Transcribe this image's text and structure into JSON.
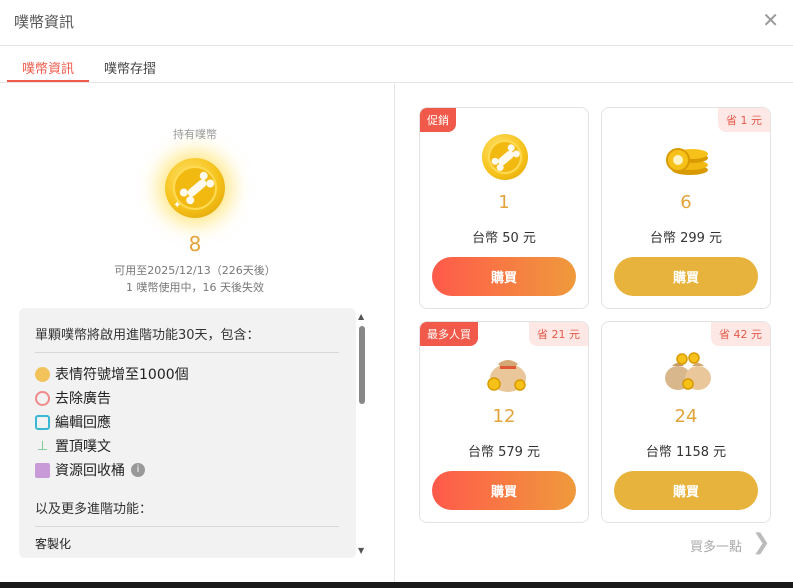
{
  "dialog": {
    "title": "噗幣資訊",
    "close_icon": "close-icon"
  },
  "tabs": [
    {
      "label": "噗幣資訊",
      "active": true
    },
    {
      "label": "噗幣存摺",
      "active": false
    }
  ],
  "holdings": {
    "label": "持有噗幣",
    "count": "8",
    "valid_until": "可用至2025/12/13（226天後）",
    "usage_status": "1 噗幣使用中，16 天後失效"
  },
  "features": {
    "intro": "單顆噗幣將啟用進階功能30天，包含：",
    "items": [
      {
        "label": "表情符號增至1000個",
        "icon": "smiley-icon",
        "color": "#f2c35a"
      },
      {
        "label": "去除廣告",
        "icon": "no-ads-icon",
        "color": "#f08a8a"
      },
      {
        "label": "編輯回應",
        "icon": "edit-icon",
        "color": "#3bb7d6"
      },
      {
        "label": "置頂噗文",
        "icon": "pin-icon",
        "color": "#6cc38a"
      },
      {
        "label": "資源回收桶",
        "icon": "trash-icon",
        "color": "#c89bd8",
        "info_icon": "info-icon"
      }
    ],
    "more": "以及更多進階功能：",
    "custom": "客製化"
  },
  "packages": [
    {
      "badge_left": "促銷",
      "badge_right": "",
      "count": "1",
      "price": "台幣 50 元",
      "buy_label": "購買",
      "style": "promo",
      "icon": "single-coin-icon"
    },
    {
      "badge_left": "",
      "badge_right": "省 1 元",
      "count": "6",
      "price": "台幣 299 元",
      "buy_label": "購買",
      "style": "normal",
      "icon": "coin-stack-icon"
    },
    {
      "badge_left": "最多人買",
      "badge_right": "省 21 元",
      "count": "12",
      "price": "台幣 579 元",
      "buy_label": "購買",
      "style": "promo",
      "icon": "coin-bag-icon"
    },
    {
      "badge_left": "",
      "badge_right": "省 42 元",
      "count": "24",
      "price": "台幣 1158 元",
      "buy_label": "購買",
      "style": "normal",
      "icon": "coin-bags-icon"
    }
  ],
  "more_link": "買多一點",
  "colors": {
    "accent": "#f15a4a",
    "gold": "#e3a33b",
    "buy_gold": "#e8b33c"
  }
}
